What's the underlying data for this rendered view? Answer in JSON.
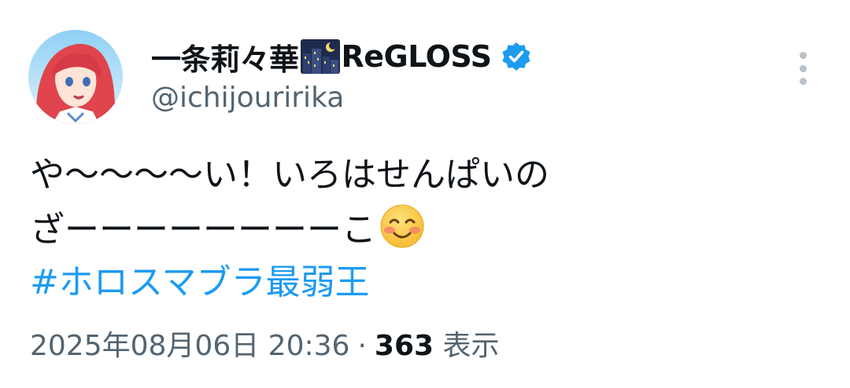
{
  "author": {
    "display_name": "一条莉々華",
    "name_emoji": "night-city-emoji",
    "name_suffix": "ReGLOSS",
    "handle": "@ichijouririka",
    "verified": true,
    "verified_color": "#1d9bf0"
  },
  "tweet": {
    "line1": "や～～～～い！いろはせんぱいの",
    "line2": "ざーーーーーーーーこ",
    "emoji": "smiling-face-with-smiling-eyes",
    "hashtag": "#ホロスマブラ最弱王"
  },
  "meta": {
    "timestamp": "2025年08月06日 20:36",
    "separator": "·",
    "views_count": "363",
    "views_label": "表示"
  },
  "colors": {
    "text": "#0f1419",
    "secondary": "#536471",
    "link": "#1d9bf0"
  }
}
